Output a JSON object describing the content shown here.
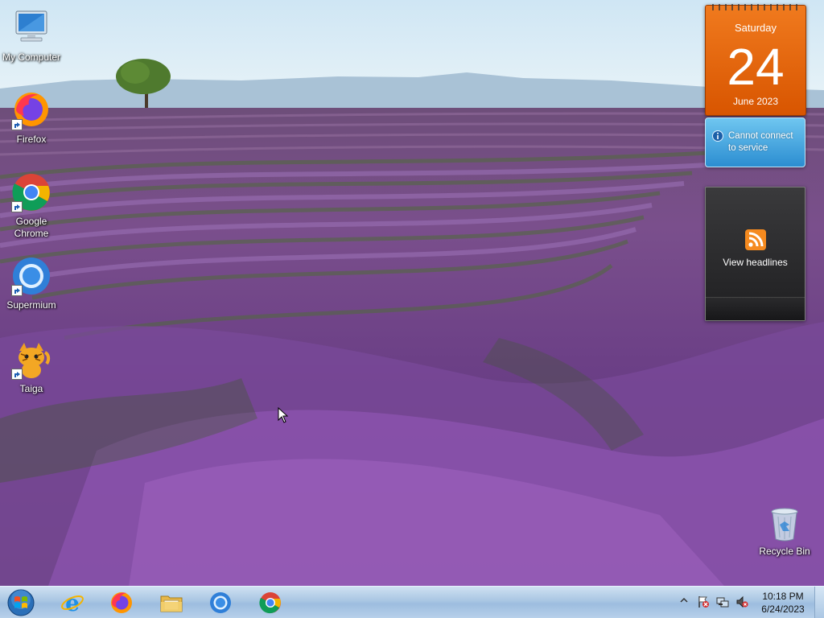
{
  "desktop": {
    "icons": [
      {
        "label": "My Computer",
        "icon": "computer-icon"
      },
      {
        "label": "Firefox",
        "icon": "firefox-icon"
      },
      {
        "label": "Google Chrome",
        "icon": "chrome-icon"
      },
      {
        "label": "Supermium",
        "icon": "supermium-icon"
      },
      {
        "label": "Taiga",
        "icon": "taiga-cat-icon"
      },
      {
        "label": "Recycle Bin",
        "icon": "recycle-bin-icon"
      }
    ]
  },
  "gadgets": {
    "calendar": {
      "day": "Saturday",
      "date": "24",
      "month_year": "June 2023",
      "color": "#e8670c"
    },
    "weather": {
      "message": "Cannot connect to service",
      "icon": "info-icon"
    },
    "feed": {
      "label": "View headlines",
      "icon": "rss-icon"
    }
  },
  "taskbar": {
    "start_icon": "windows-start-orb",
    "pinned": [
      {
        "name": "Internet Explorer",
        "icon": "internet-explorer-icon"
      },
      {
        "name": "Firefox",
        "icon": "firefox-icon"
      },
      {
        "name": "Windows Explorer",
        "icon": "folder-icon"
      },
      {
        "name": "Supermium",
        "icon": "supermium-icon"
      },
      {
        "name": "Google Chrome",
        "icon": "chrome-icon"
      }
    ],
    "tray": {
      "icons": [
        "show-hidden-icons-chevron",
        "action-center-flag-icon",
        "network-icon",
        "volume-muted-icon"
      ],
      "time": "10:18 PM",
      "date": "6/24/2023"
    }
  }
}
